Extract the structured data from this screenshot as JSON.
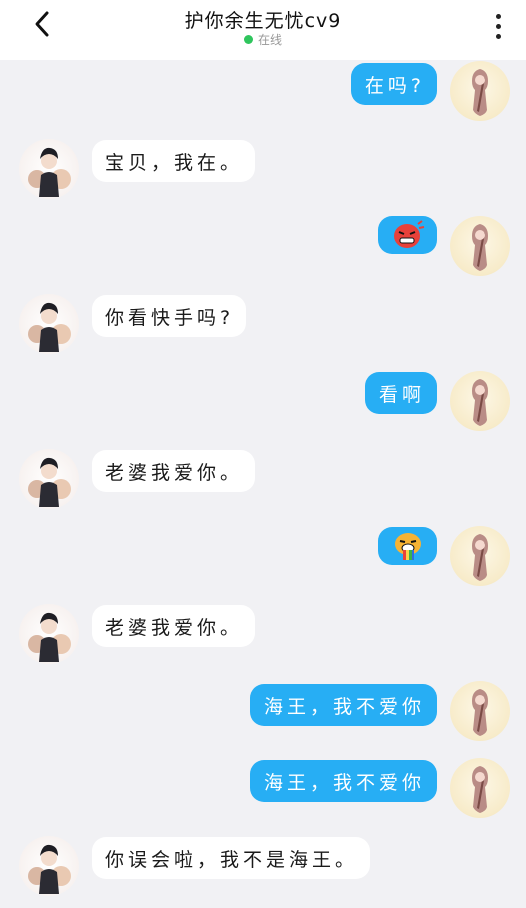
{
  "header": {
    "title": "护你余生无忧cv9",
    "status": "在线"
  },
  "messages": [
    {
      "from": "me",
      "text": "在吗?"
    },
    {
      "from": "other",
      "text": "宝贝，我在。"
    },
    {
      "from": "me",
      "sticker": "angry-face-sticker"
    },
    {
      "from": "other",
      "text": "你看快手吗?"
    },
    {
      "from": "me",
      "text": "看啊"
    },
    {
      "from": "other",
      "text": "老婆我爱你。"
    },
    {
      "from": "me",
      "sticker": "rainbow-vomit-sticker"
    },
    {
      "from": "other",
      "text": "老婆我爱你。"
    },
    {
      "from": "me",
      "text": "海王，我不爱你"
    },
    {
      "from": "me",
      "text": "海王，我不爱你"
    },
    {
      "from": "other",
      "text": "你误会啦，我不是海王。"
    }
  ],
  "colors": {
    "my_bubble": "#27aef4",
    "other_bubble": "#ffffff",
    "online_dot": "#2fc55d",
    "background": "#f1f1f4"
  }
}
